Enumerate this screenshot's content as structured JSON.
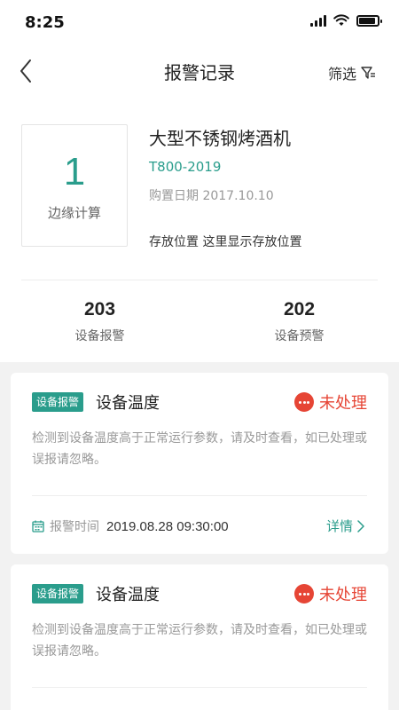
{
  "status_bar": {
    "time": "8:25"
  },
  "nav": {
    "title": "报警记录",
    "filter_label": "筛选"
  },
  "device": {
    "compute_count": "1",
    "compute_label": "边缘计算",
    "name": "大型不锈钢烤酒机",
    "model": "T800-2019",
    "purchase_label": "购置日期",
    "purchase_date": "2017.10.10",
    "storage_label": "存放位置",
    "storage_value": "这里显示存放位置"
  },
  "stats": [
    {
      "value": "203",
      "label": "设备报警"
    },
    {
      "value": "202",
      "label": "设备预警"
    }
  ],
  "alarms": [
    {
      "tag": "设备报警",
      "title": "设备温度",
      "status": "未处理",
      "description": "检测到设备温度高于正常运行参数，请及时查看，如已处理或误报请忽略。",
      "time_label": "报警时间",
      "time": "2019.08.28 09:30:00",
      "detail_label": "详情"
    },
    {
      "tag": "设备报警",
      "title": "设备温度",
      "status": "未处理",
      "description": "检测到设备温度高于正常运行参数，请及时查看，如已处理或误报请忽略。"
    }
  ],
  "colors": {
    "accent": "#2a9d8c",
    "alert": "#e64535"
  }
}
